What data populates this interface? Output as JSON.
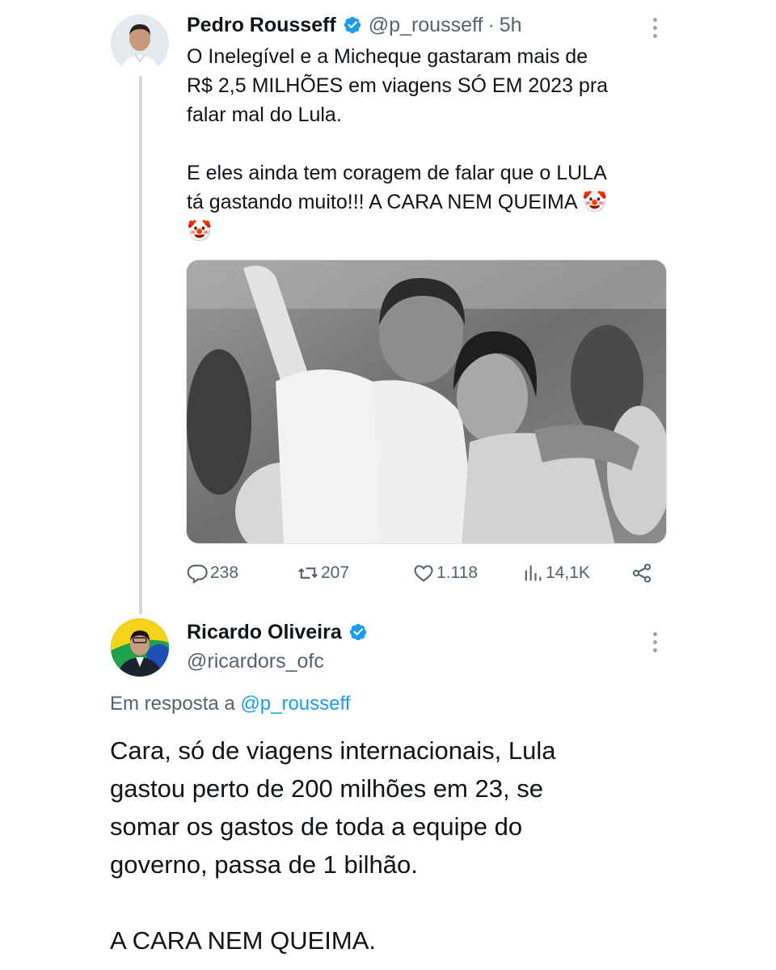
{
  "colors": {
    "verified": "#1d9bf0",
    "link": "#1d9bf0",
    "muted": "#536471",
    "thread_line": "#cfd9de"
  },
  "tweet": {
    "author": {
      "display_name": "Pedro Rousseff",
      "handle": "@p_rousseff",
      "separator": "·",
      "time": "5h",
      "verified_icon": "verified-badge-icon"
    },
    "text_paragraphs": [
      "O Inelegível e a Micheque gastaram mais de\nR$ 2,5 MILHÕES em viagens SÓ EM 2023 pra\nfalar mal do Lula.",
      "E eles ainda tem coragem de falar que o LULA\ntá gastando muito!!! A CARA NEM QUEIMA 🤡\n🤡"
    ],
    "media_icon": "photo",
    "actions": {
      "replies": "238",
      "retweets": "207",
      "likes": "1.118",
      "views": "14,1K"
    }
  },
  "reply": {
    "author": {
      "display_name": "Ricardo Oliveira",
      "handle": "@ricardors_ofc",
      "verified_icon": "verified-badge-icon"
    },
    "reply_to_label": "Em resposta a",
    "reply_to_handle": "@p_rousseff",
    "text_paragraphs": [
      "Cara, só de viagens internacionais, Lula\ngastou perto de 200 milhões em 23, se\nsomar os gastos de toda a equipe do\ngoverno, passa de 1 bilhão.",
      "A CARA NEM QUEIMA."
    ]
  }
}
